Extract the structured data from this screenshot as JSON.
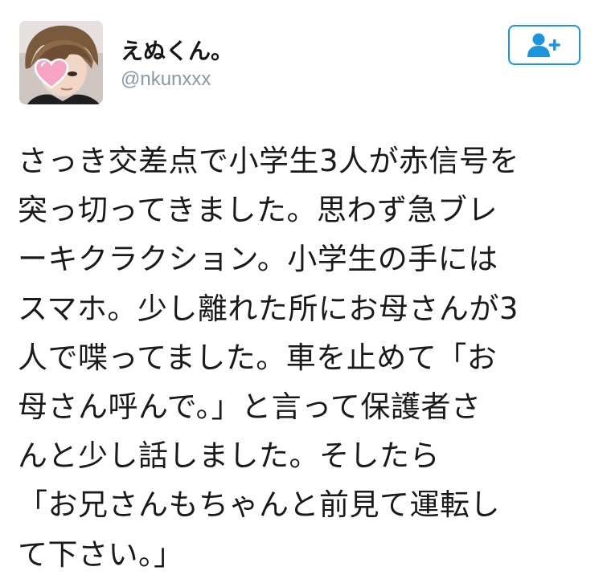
{
  "user": {
    "display_name": "えぬくん。",
    "handle": "@nkunxxx",
    "avatar_icon": "profile-photo",
    "heart_sticker_icon": "heart-icon"
  },
  "follow_button": {
    "icon": "add-user-icon",
    "accent_color": "#1d95dd"
  },
  "tweet": {
    "lines": [
      "さっき交差点で小学生3人が赤信号を",
      "突っ切ってきました。思わず急ブレ",
      "ーキクラクション。小学生の手には",
      "スマホ。少し離れた所にお母さんが3",
      "人で喋ってました。車を止めて「お",
      "母さん呼んで。」と言って保護者さ",
      "んと少し話しました。そしたら",
      "「お兄さんもちゃんと前見て運転し",
      "て下さい。」"
    ]
  }
}
